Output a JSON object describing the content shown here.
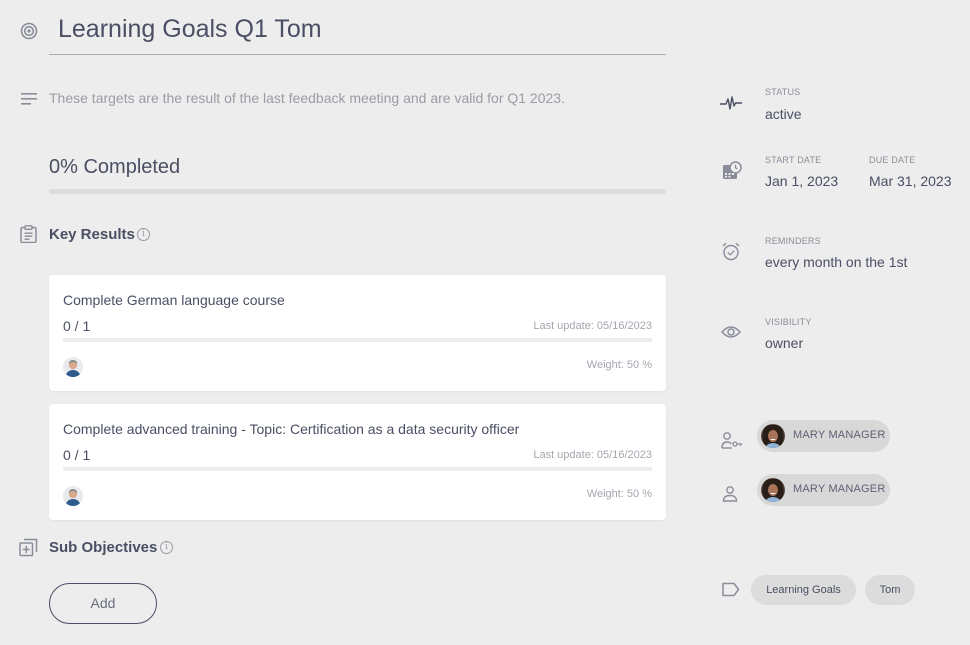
{
  "objective": {
    "title": "Learning Goals Q1 Tom",
    "description": "These targets are the result of the last feedback meeting and are valid for Q1 2023.",
    "completed_label": "0% Completed",
    "progress_percent": 0
  },
  "key_results": {
    "heading": "Key Results",
    "items": [
      {
        "title": "Complete German language course",
        "count": "0 / 1",
        "progress_fraction": 0,
        "last_update": "Last update: 05/16/2023",
        "weight": "Weight: 50 %"
      },
      {
        "title": "Complete advanced training - Topic: Certification as a data security officer",
        "count": "0 / 1",
        "progress_fraction": 0,
        "last_update": "Last update: 05/16/2023",
        "weight": "Weight: 50 %"
      }
    ]
  },
  "sub_objectives": {
    "heading": "Sub Objectives",
    "add_label": "Add"
  },
  "sidebar": {
    "status": {
      "label": "STATUS",
      "value": "active"
    },
    "start_date": {
      "label": "START DATE",
      "value": "Jan 1, 2023"
    },
    "due_date": {
      "label": "DUE DATE",
      "value": "Mar 31, 2023"
    },
    "reminders": {
      "label": "REMINDERS",
      "value": "every month on the 1st"
    },
    "visibility": {
      "label": "VISIBILITY",
      "value": "owner"
    },
    "owner": {
      "name": "MARY MANAGER"
    },
    "assignee": {
      "name": "MARY MANAGER"
    },
    "tags": [
      "Learning Goals",
      "Tom"
    ]
  },
  "colors": {
    "accent": "#4a4f63",
    "background": "#ededed",
    "muted_text": "#9a9ca6"
  }
}
